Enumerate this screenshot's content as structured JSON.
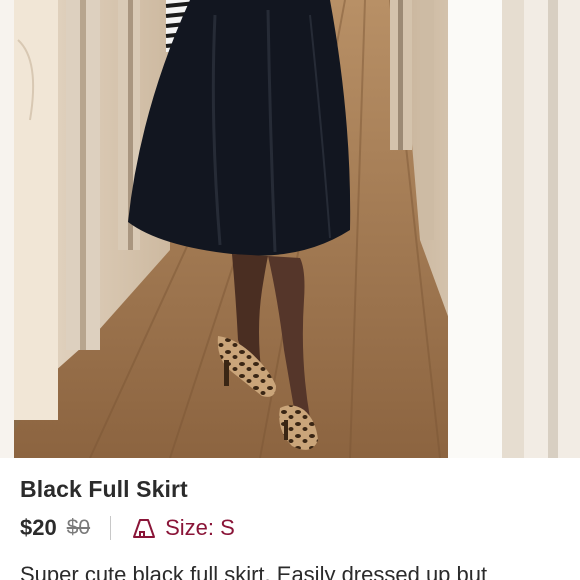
{
  "listing": {
    "title": "Black Full Skirt",
    "price": "$20",
    "original_price": "$0",
    "size_label": "Size: S",
    "description": "Super cute black full skirt. Easily dressed up but",
    "size_icon": "hanger-icon"
  },
  "colors": {
    "accent": "#8a1538",
    "text": "#2b2b2b",
    "muted": "#7a7a7a"
  }
}
